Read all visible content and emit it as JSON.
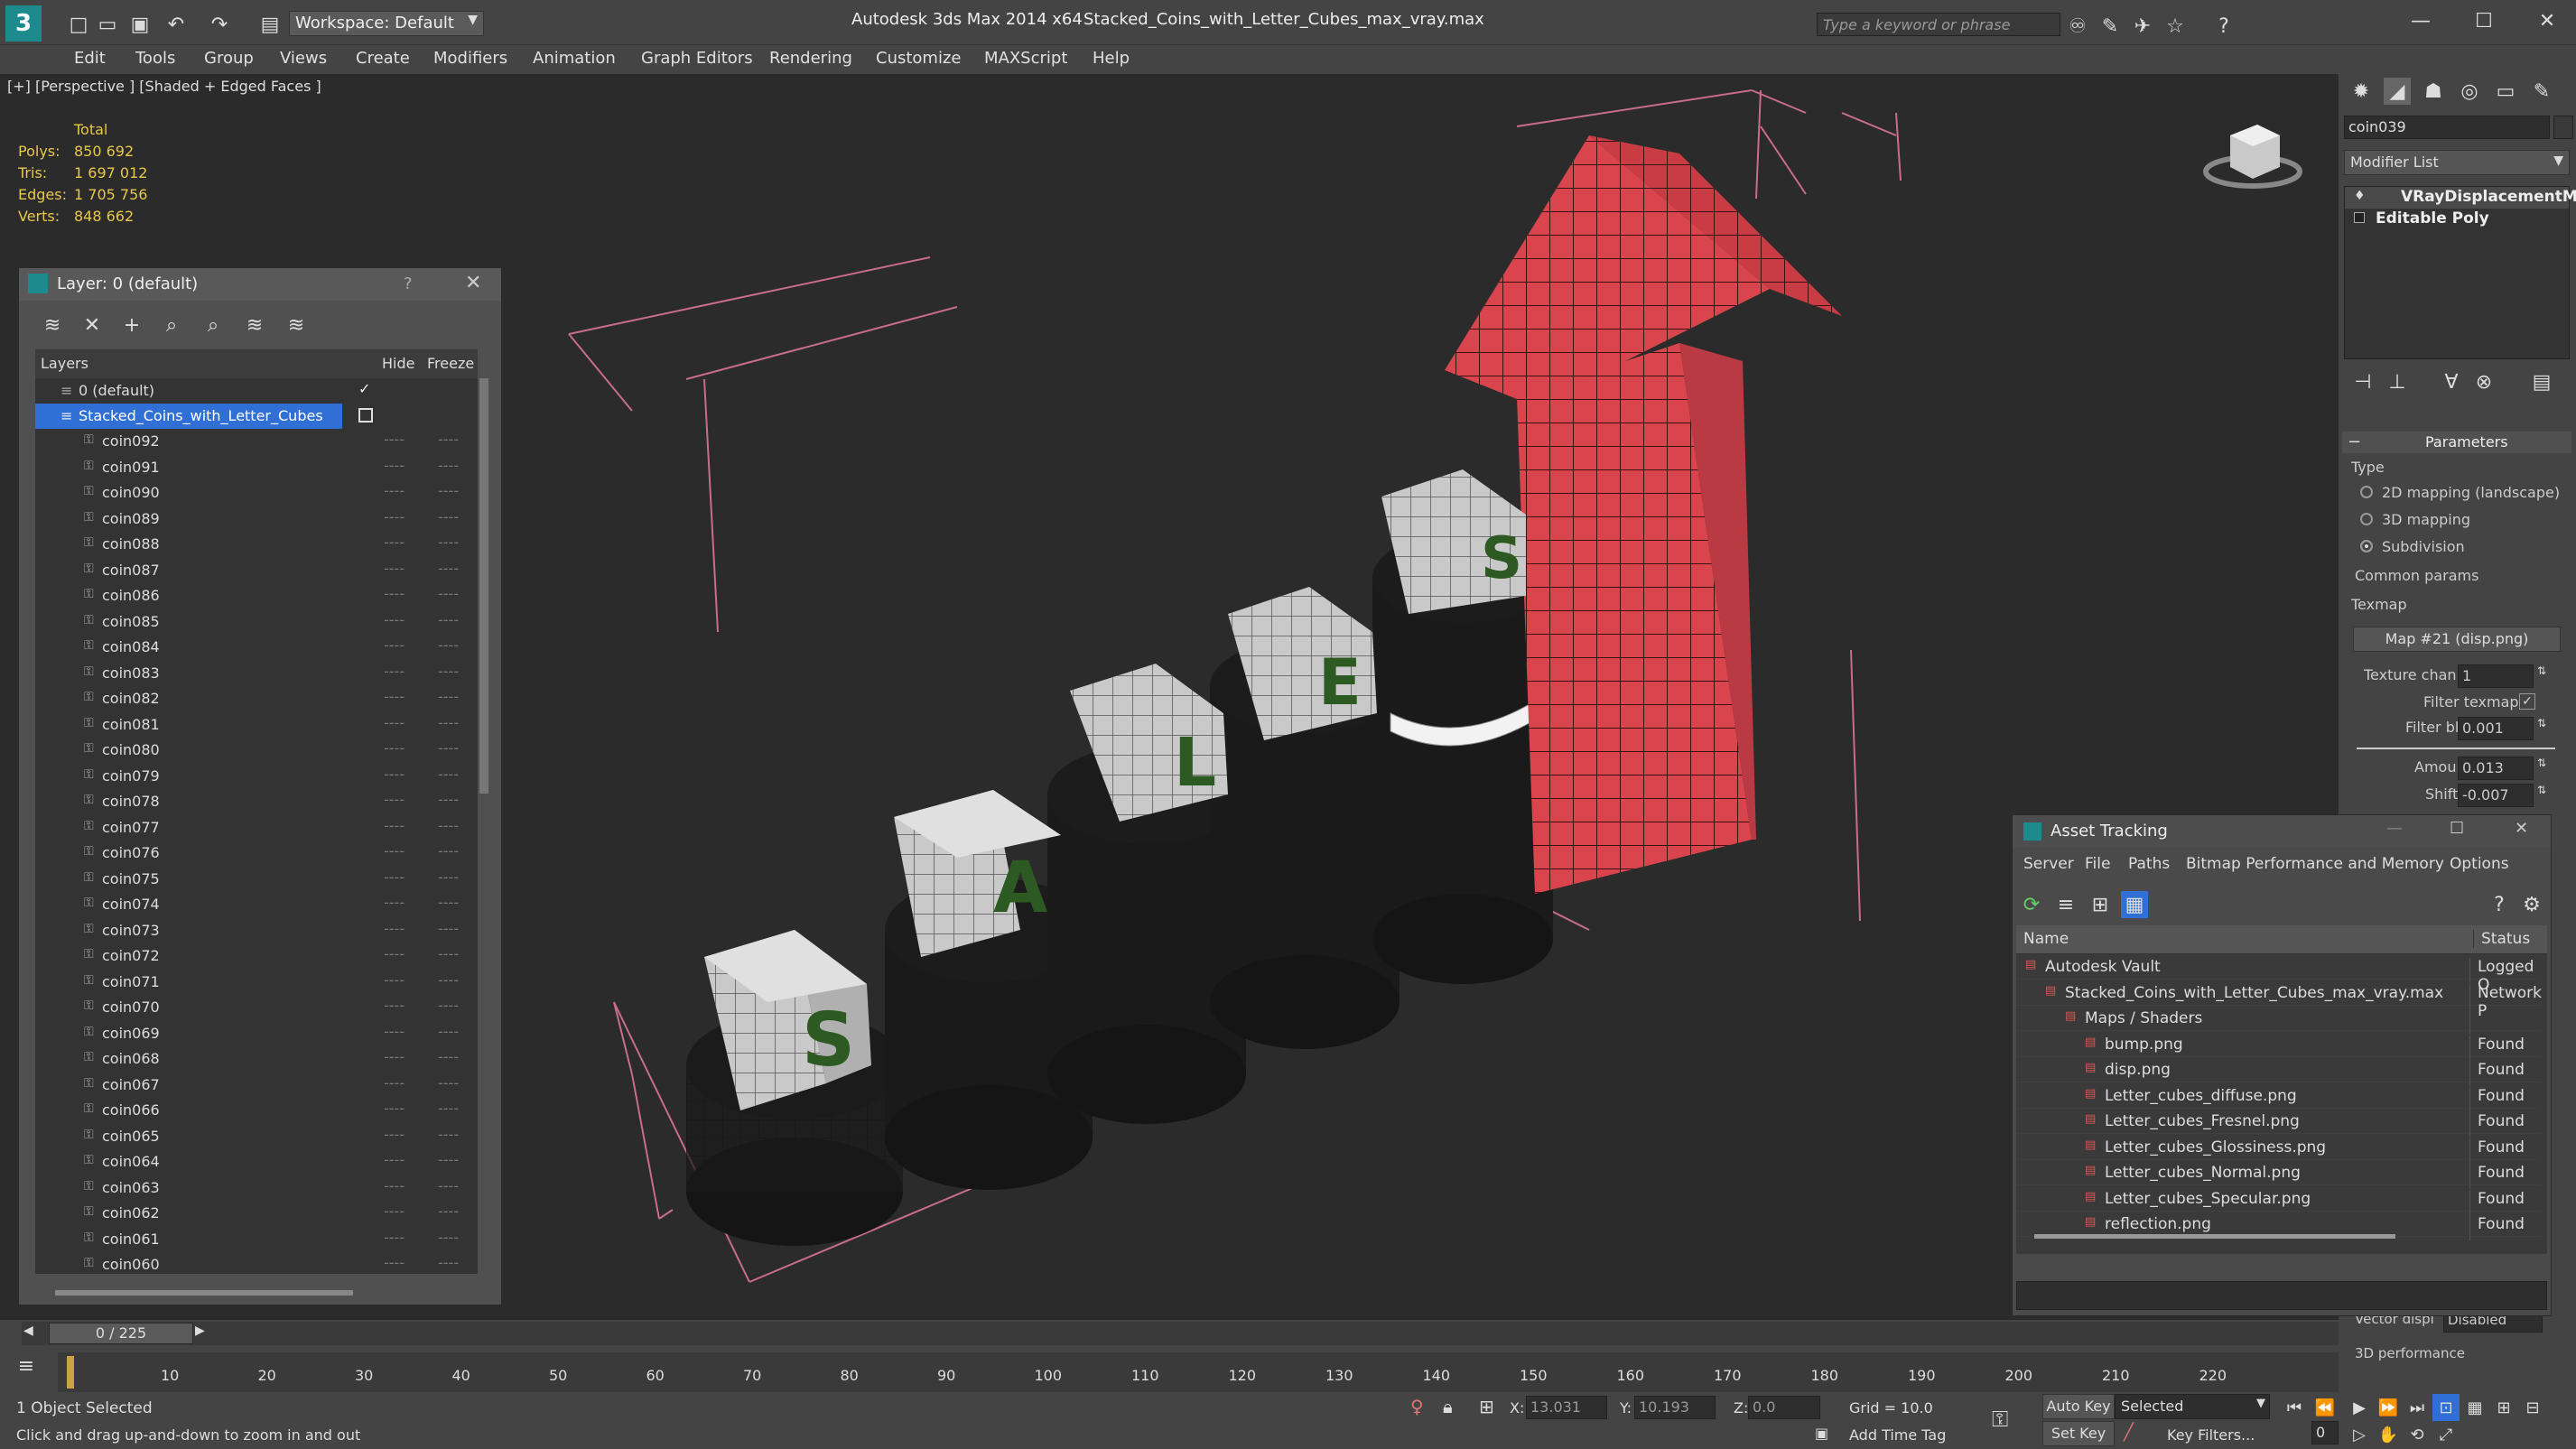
{
  "window": {
    "app_title": "Autodesk 3ds Max  2014 x64",
    "file_title": "Stacked_Coins_with_Letter_Cubes_max_vray.max",
    "workspace": "Workspace: Default",
    "search_placeholder": "Type a keyword or phrase"
  },
  "menu": [
    "Edit",
    "Tools",
    "Group",
    "Views",
    "Create",
    "Modifiers",
    "Animation",
    "Graph Editors",
    "Rendering",
    "Customize",
    "MAXScript",
    "Help"
  ],
  "viewport": {
    "label": "[+] [Perspective ] [Shaded + Edged Faces ]",
    "stats": {
      "header": "Total",
      "labels": [
        "Polys:",
        "Tris:",
        "Edges:",
        "Verts:"
      ],
      "values": [
        "850 692",
        "1 697 012",
        "1 705 756",
        "848 662"
      ]
    },
    "cube_letters": [
      "S",
      "A",
      "L",
      "E",
      "S"
    ]
  },
  "layer_panel": {
    "title": "Layer: 0 (default)",
    "help": "?",
    "col_layers": "Layers",
    "col_hide": "Hide",
    "col_freeze": "Freeze",
    "layers": [
      "0 (default)",
      "Stacked_Coins_with_Letter_Cubes"
    ],
    "objects": [
      "coin092",
      "coin091",
      "coin090",
      "coin089",
      "coin088",
      "coin087",
      "coin086",
      "coin085",
      "coin084",
      "coin083",
      "coin082",
      "coin081",
      "coin080",
      "coin079",
      "coin078",
      "coin077",
      "coin076",
      "coin075",
      "coin074",
      "coin073",
      "coin072",
      "coin071",
      "coin070",
      "coin069",
      "coin068",
      "coin067",
      "coin066",
      "coin065",
      "coin064",
      "coin063",
      "coin062",
      "coin061",
      "coin060"
    ]
  },
  "command_panel": {
    "object_name": "coin039",
    "modifier_list": "Modifier List",
    "modifiers": [
      "VRayDisplacementM",
      "Editable Poly"
    ],
    "rollout_title": "Parameters",
    "type_label": "Type",
    "type_options": [
      "2D mapping (landscape)",
      "3D mapping",
      "Subdivision"
    ],
    "selected_type_index": 2,
    "common_params": "Common params",
    "texmap_label": "Texmap",
    "texmap_value": "Map #21 (disp.png)",
    "texture_chan_label": "Texture chan",
    "texture_chan_value": "1",
    "filter_texmap_label": "Filter texmap",
    "filter_blur_label": "Filter blur",
    "filter_blur_value": "0.001",
    "amount_label": "Amount",
    "amount_value": "0.013",
    "shift_label": "Shift",
    "shift_value": "-0.007",
    "vector_disp_label": "Vector displ",
    "vector_disp_value": "Disabled",
    "perf_label": "3D performance"
  },
  "asset_tracking": {
    "title": "Asset Tracking",
    "menu": [
      "Server",
      "File",
      "Paths",
      "Bitmap Performance and Memory",
      "Options"
    ],
    "col_name": "Name",
    "col_status": "Status",
    "rows": [
      {
        "name": "Autodesk Vault",
        "status": "Logged O",
        "indent": 1
      },
      {
        "name": "Stacked_Coins_with_Letter_Cubes_max_vray.max",
        "status": "Network P",
        "indent": 2
      },
      {
        "name": "Maps / Shaders",
        "status": "",
        "indent": 3
      },
      {
        "name": "bump.png",
        "status": "Found",
        "indent": 4
      },
      {
        "name": "disp.png",
        "status": "Found",
        "indent": 4
      },
      {
        "name": "Letter_cubes_diffuse.png",
        "status": "Found",
        "indent": 4
      },
      {
        "name": "Letter_cubes_Fresnel.png",
        "status": "Found",
        "indent": 4
      },
      {
        "name": "Letter_cubes_Glossiness.png",
        "status": "Found",
        "indent": 4
      },
      {
        "name": "Letter_cubes_Normal.png",
        "status": "Found",
        "indent": 4
      },
      {
        "name": "Letter_cubes_Specular.png",
        "status": "Found",
        "indent": 4
      },
      {
        "name": "reflection.png",
        "status": "Found",
        "indent": 4
      }
    ]
  },
  "timeline": {
    "frame_counter": "0 / 225",
    "ticks": [
      "10",
      "20",
      "30",
      "40",
      "50",
      "60",
      "70",
      "80",
      "90",
      "100",
      "110",
      "120",
      "130",
      "140",
      "150",
      "160",
      "170",
      "180",
      "190",
      "200",
      "210",
      "220"
    ]
  },
  "status": {
    "selection": "1 Object Selected",
    "prompt": "Click and drag up-and-down to zoom in and out",
    "x_label": "X:",
    "x_value": "13.031",
    "y_label": "Y:",
    "y_value": "10.193",
    "z_label": "Z:",
    "z_value": "0.0",
    "grid": "Grid = 10.0",
    "add_time_tag": "Add Time Tag",
    "auto_key": "Auto Key",
    "set_key": "Set Key",
    "key_mode": "Selected",
    "key_filters": "Key Filters...",
    "frame": "0"
  },
  "colors": {
    "accent": "#2f6fd6",
    "viewport_bg": "#2b2b2b",
    "arrow_red": "#d9444d",
    "stats_yellow": "#e8c84a",
    "letter_green": "#2d5a22"
  }
}
